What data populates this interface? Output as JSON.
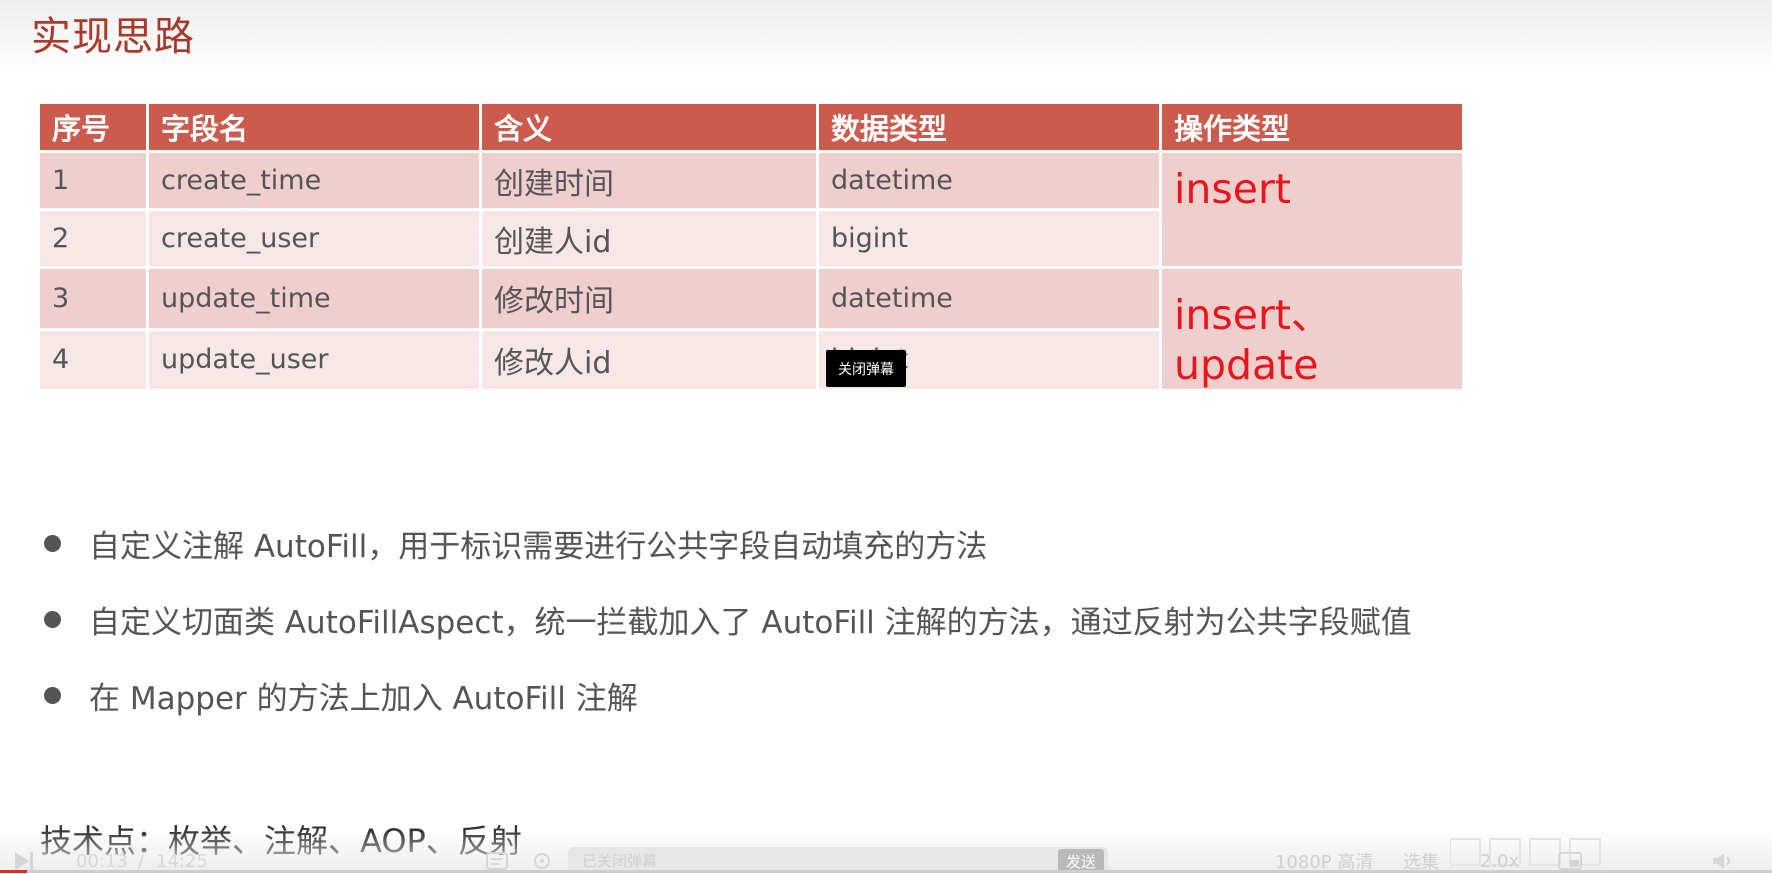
{
  "slide": {
    "title": "实现思路",
    "table": {
      "headers": [
        "序号",
        "字段名",
        "含义",
        "数据类型",
        "操作类型"
      ],
      "rows": [
        {
          "no": "1",
          "field": "create_time",
          "meaning": "创建时间",
          "type": "datetime"
        },
        {
          "no": "2",
          "field": "create_user",
          "meaning": "创建人id",
          "type": "bigint"
        },
        {
          "no": "3",
          "field": "update_time",
          "meaning": "修改时间",
          "type": "datetime"
        },
        {
          "no": "4",
          "field": "update_user",
          "meaning": "修改人id",
          "type": "bigint"
        }
      ],
      "operations": [
        "insert",
        "insert、 update"
      ]
    },
    "bullets": [
      "自定义注解 AutoFill，用于标识需要进行公共字段自动填充的方法",
      "自定义切面类 AutoFillAspect，统一拦截加入了 AutoFill 注解的方法，通过反射为公共字段赋值",
      "在 Mapper 的方法上加入 AutoFill 注解"
    ],
    "tech_points": "技术点：枚举、注解、AOP、反射"
  },
  "overlay": {
    "close_danmaku_label": "关闭弹幕"
  },
  "player": {
    "current_time": "00:13",
    "separator": "/",
    "total_time": "14:25",
    "danmaku_placeholder": "已关闭弹幕",
    "send_label": "发送",
    "quality_label": "1080P 高清",
    "episodes_label": "选集",
    "speed_label": "2.0x",
    "progress": 0.015,
    "icons": [
      "play-icon",
      "danmaku-toggle-icon",
      "danmaku-settings-icon",
      "pip-icon",
      "volume-icon"
    ],
    "accent_color": "#e02a2a"
  },
  "colors": {
    "header_bg": "#cb5b4d",
    "row_dark": "#efcfcd",
    "row_light": "#f7e7e6",
    "operation_text": "#e8161c",
    "title_text": "#a93a2b"
  }
}
